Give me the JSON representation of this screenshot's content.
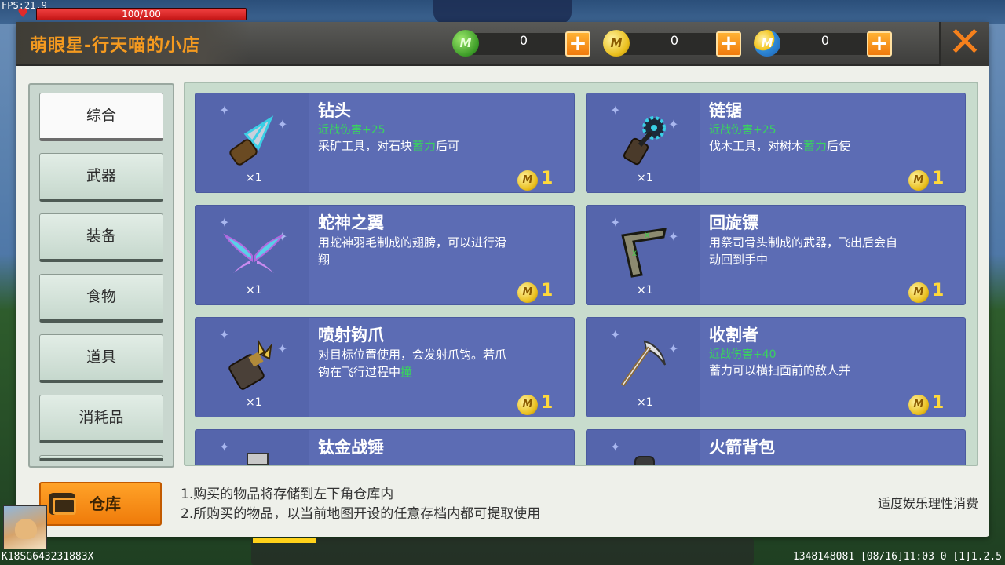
{
  "hud": {
    "fps": "FPS:21.9",
    "hp_text": "100/100",
    "hp_fraction": 1.0
  },
  "shop": {
    "title": "萌眼星-行天喵的小店",
    "currencies": [
      {
        "icon": "green-gem-coin-icon",
        "value": "0"
      },
      {
        "icon": "gold-coin-icon",
        "value": "0"
      },
      {
        "icon": "mini-coin-icon",
        "value": "0"
      }
    ],
    "close_label": "✕"
  },
  "categories": [
    {
      "label": "综合",
      "active": true
    },
    {
      "label": "武器"
    },
    {
      "label": "装备"
    },
    {
      "label": "食物"
    },
    {
      "label": "道具"
    },
    {
      "label": "消耗品"
    }
  ],
  "items": [
    {
      "name": "钻头",
      "stat": "近战伤害+25",
      "desc_a": "采矿工具，对石块",
      "desc_hl": "蓄力",
      "desc_b": "后可",
      "qty": "×1",
      "price": "1",
      "icon": "drill-icon"
    },
    {
      "name": "链锯",
      "stat": "近战伤害+25",
      "desc_a": "伐木工具，对树木",
      "desc_hl": "蓄力",
      "desc_b": "后使",
      "qty": "×1",
      "price": "1",
      "icon": "chainsaw-icon"
    },
    {
      "name": "蛇神之翼",
      "stat": "",
      "desc_a": "用蛇神羽毛制成的翅膀，可以进行滑翔",
      "desc_hl": "",
      "desc_b": "",
      "qty": "×1",
      "price": "1",
      "icon": "wings-icon"
    },
    {
      "name": "回旋镖",
      "stat": "",
      "desc_a": "用祭司骨头制成的武器，飞出后会自动回到手中",
      "desc_hl": "",
      "desc_b": "",
      "qty": "×1",
      "price": "1",
      "icon": "boomerang-icon"
    },
    {
      "name": "喷射钩爪",
      "stat": "",
      "desc_a": "对目标位置使用，会发射爪钩。若爪钩在飞行过程中",
      "desc_hl": "撞",
      "desc_b": "",
      "qty": "×1",
      "price": "1",
      "icon": "grapple-claw-icon"
    },
    {
      "name": "收割者",
      "stat": "近战伤害+40",
      "desc_a": "蓄力可以横扫面前的敌人并",
      "desc_hl": "",
      "desc_b": "",
      "qty": "×1",
      "price": "1",
      "icon": "scythe-icon"
    },
    {
      "name": "钛金战锤",
      "stat": "",
      "desc_a": "",
      "desc_hl": "",
      "desc_b": "",
      "qty": "",
      "price": "",
      "icon": "hammer-icon"
    },
    {
      "name": "火箭背包",
      "stat": "",
      "desc_a": "",
      "desc_hl": "",
      "desc_b": "",
      "qty": "",
      "price": "",
      "icon": "jetpack-icon"
    }
  ],
  "footer": {
    "warehouse_label": "仓库",
    "note1": "1.购买的物品将存储到左下角仓库内",
    "note2": "2.所购买的物品，以当前地图开设的任意存档内都可提取使用",
    "notice": "适度娱乐理性消费"
  },
  "bottom": {
    "device_id": "K18SG643231883X",
    "build_info": "1348148081  [08/16]11:03 0  [1]1.2.5"
  }
}
